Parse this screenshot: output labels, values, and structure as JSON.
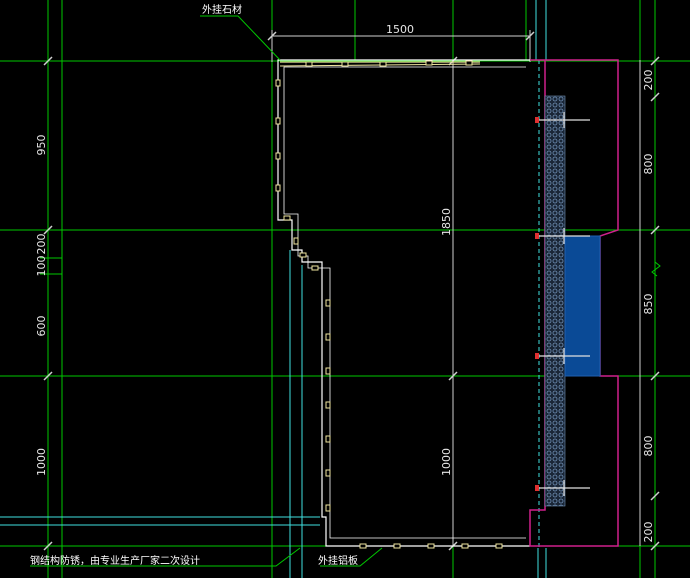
{
  "drawing": {
    "dimensions": {
      "top_width": "1500",
      "left_950": "950",
      "left_200": "200",
      "left_100": "100",
      "left_600": "600",
      "left_1000": "1000",
      "center_1850": "1850",
      "center_1000": "1000",
      "right_200_top": "200",
      "right_800_top": "800",
      "right_850": "850",
      "right_800_bottom": "800",
      "right_200_bottom": "200"
    },
    "notes": {
      "stone_cladding": "外挂石材",
      "aluminum_panel": "外挂铝板",
      "steel_frame_note": "钢结构防锈，由专业生产厂家二次设计"
    },
    "colors": {
      "background": "#000000",
      "grid_green": "#00c800",
      "dim_line": "#cfcfcf",
      "wall_outline": "#ffffff",
      "profile_yellow": "#f0e6a0",
      "cyan": "#40e0e0",
      "magenta": "#d0208c",
      "blue_panel": "#0a4a96",
      "insulation": "#6f8fb4"
    }
  }
}
